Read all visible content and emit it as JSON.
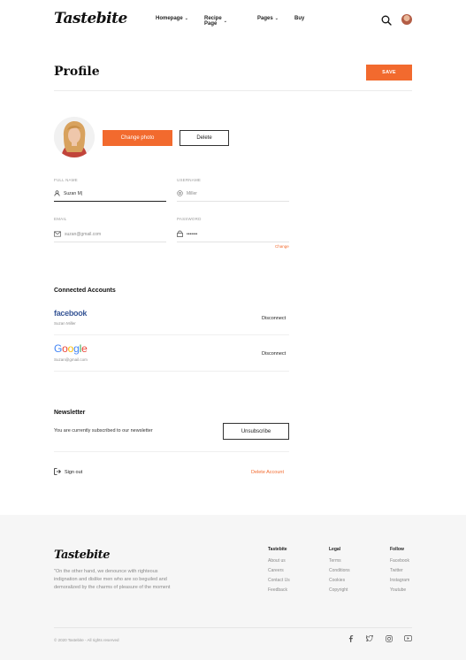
{
  "header": {
    "logo": "Tastebite",
    "nav": [
      {
        "label": "Homepage",
        "has_menu": true
      },
      {
        "label": "Recipe Page",
        "has_menu": true
      },
      {
        "label": "Pages",
        "has_menu": true
      },
      {
        "label": "Buy",
        "has_menu": false
      }
    ],
    "search_icon": "search-icon",
    "avatar_icon": "user-avatar"
  },
  "profile": {
    "title": "Profile",
    "save_label": "SAVE",
    "change_photo_label": "Change photo",
    "delete_label": "Delete",
    "fields": {
      "full_name": {
        "label": "FULL NAME",
        "value": "Suzan M|",
        "icon": "user-icon"
      },
      "username": {
        "label": "USERNAME",
        "value": "Miller",
        "icon": "at-icon"
      },
      "email": {
        "label": "EMAIL",
        "value": "suzan@gmail.com",
        "icon": "mail-icon"
      },
      "password": {
        "label": "PASSWORD",
        "value": "•••••••",
        "icon": "lock-icon"
      }
    },
    "change_link": "Change"
  },
  "connected_accounts": {
    "title": "Connected Accounts",
    "accounts": [
      {
        "brand": "facebook",
        "sub": "Suzan Miller",
        "action": "Disconnect",
        "color": "#3b5998"
      },
      {
        "brand": "Google",
        "sub": "Suzan@gmail.com",
        "action": "Disconnect",
        "color": "#4285f4"
      }
    ]
  },
  "newsletter": {
    "title": "Newsletter",
    "text": "You are currently subscribed to our newsletter",
    "button": "Unsubscribe"
  },
  "account_actions": {
    "sign_out": "Sign out",
    "delete_account": "Delete Account"
  },
  "footer": {
    "logo": "Tastebite",
    "quote": "\"On the other hand, we denounce with righteous indignation and dislike men who are so beguiled and demoralized by the charms of pleasure of the moment",
    "columns": [
      {
        "title": "Tastebite",
        "links": [
          "About us",
          "Careers",
          "Contact Us",
          "Feedback"
        ]
      },
      {
        "title": "Legal",
        "links": [
          "Terms",
          "Conditions",
          "Cookies",
          "Copyright"
        ]
      },
      {
        "title": "Follow",
        "links": [
          "Facebook",
          "Twitter",
          "Instagram",
          "Youtube"
        ]
      }
    ],
    "copyright": "© 2020 Tastebite - All rights reserved",
    "socials": [
      "facebook-icon",
      "twitter-icon",
      "instagram-icon",
      "youtube-icon"
    ]
  },
  "colors": {
    "accent": "#f26a2e",
    "footer_bg": "#f6f6f6",
    "text": "#1f1f1f"
  }
}
